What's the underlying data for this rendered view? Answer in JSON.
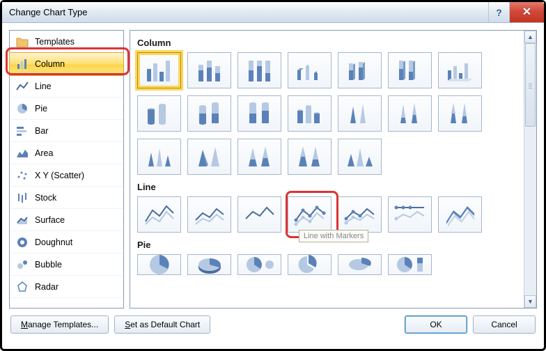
{
  "window": {
    "title": "Change Chart Type"
  },
  "sidebar": {
    "items": [
      {
        "label": "Templates"
      },
      {
        "label": "Column"
      },
      {
        "label": "Line"
      },
      {
        "label": "Pie"
      },
      {
        "label": "Bar"
      },
      {
        "label": "Area"
      },
      {
        "label": "X Y (Scatter)"
      },
      {
        "label": "Stock"
      },
      {
        "label": "Surface"
      },
      {
        "label": "Doughnut"
      },
      {
        "label": "Bubble"
      },
      {
        "label": "Radar"
      }
    ],
    "selected": "Column"
  },
  "sections": {
    "column": "Column",
    "line": "Line",
    "pie": "Pie"
  },
  "tooltip": {
    "text": "Line with Markers"
  },
  "footer": {
    "manage_templates": "Manage Templates...",
    "set_default": "Set as Default Chart",
    "ok": "OK",
    "cancel": "Cancel"
  }
}
